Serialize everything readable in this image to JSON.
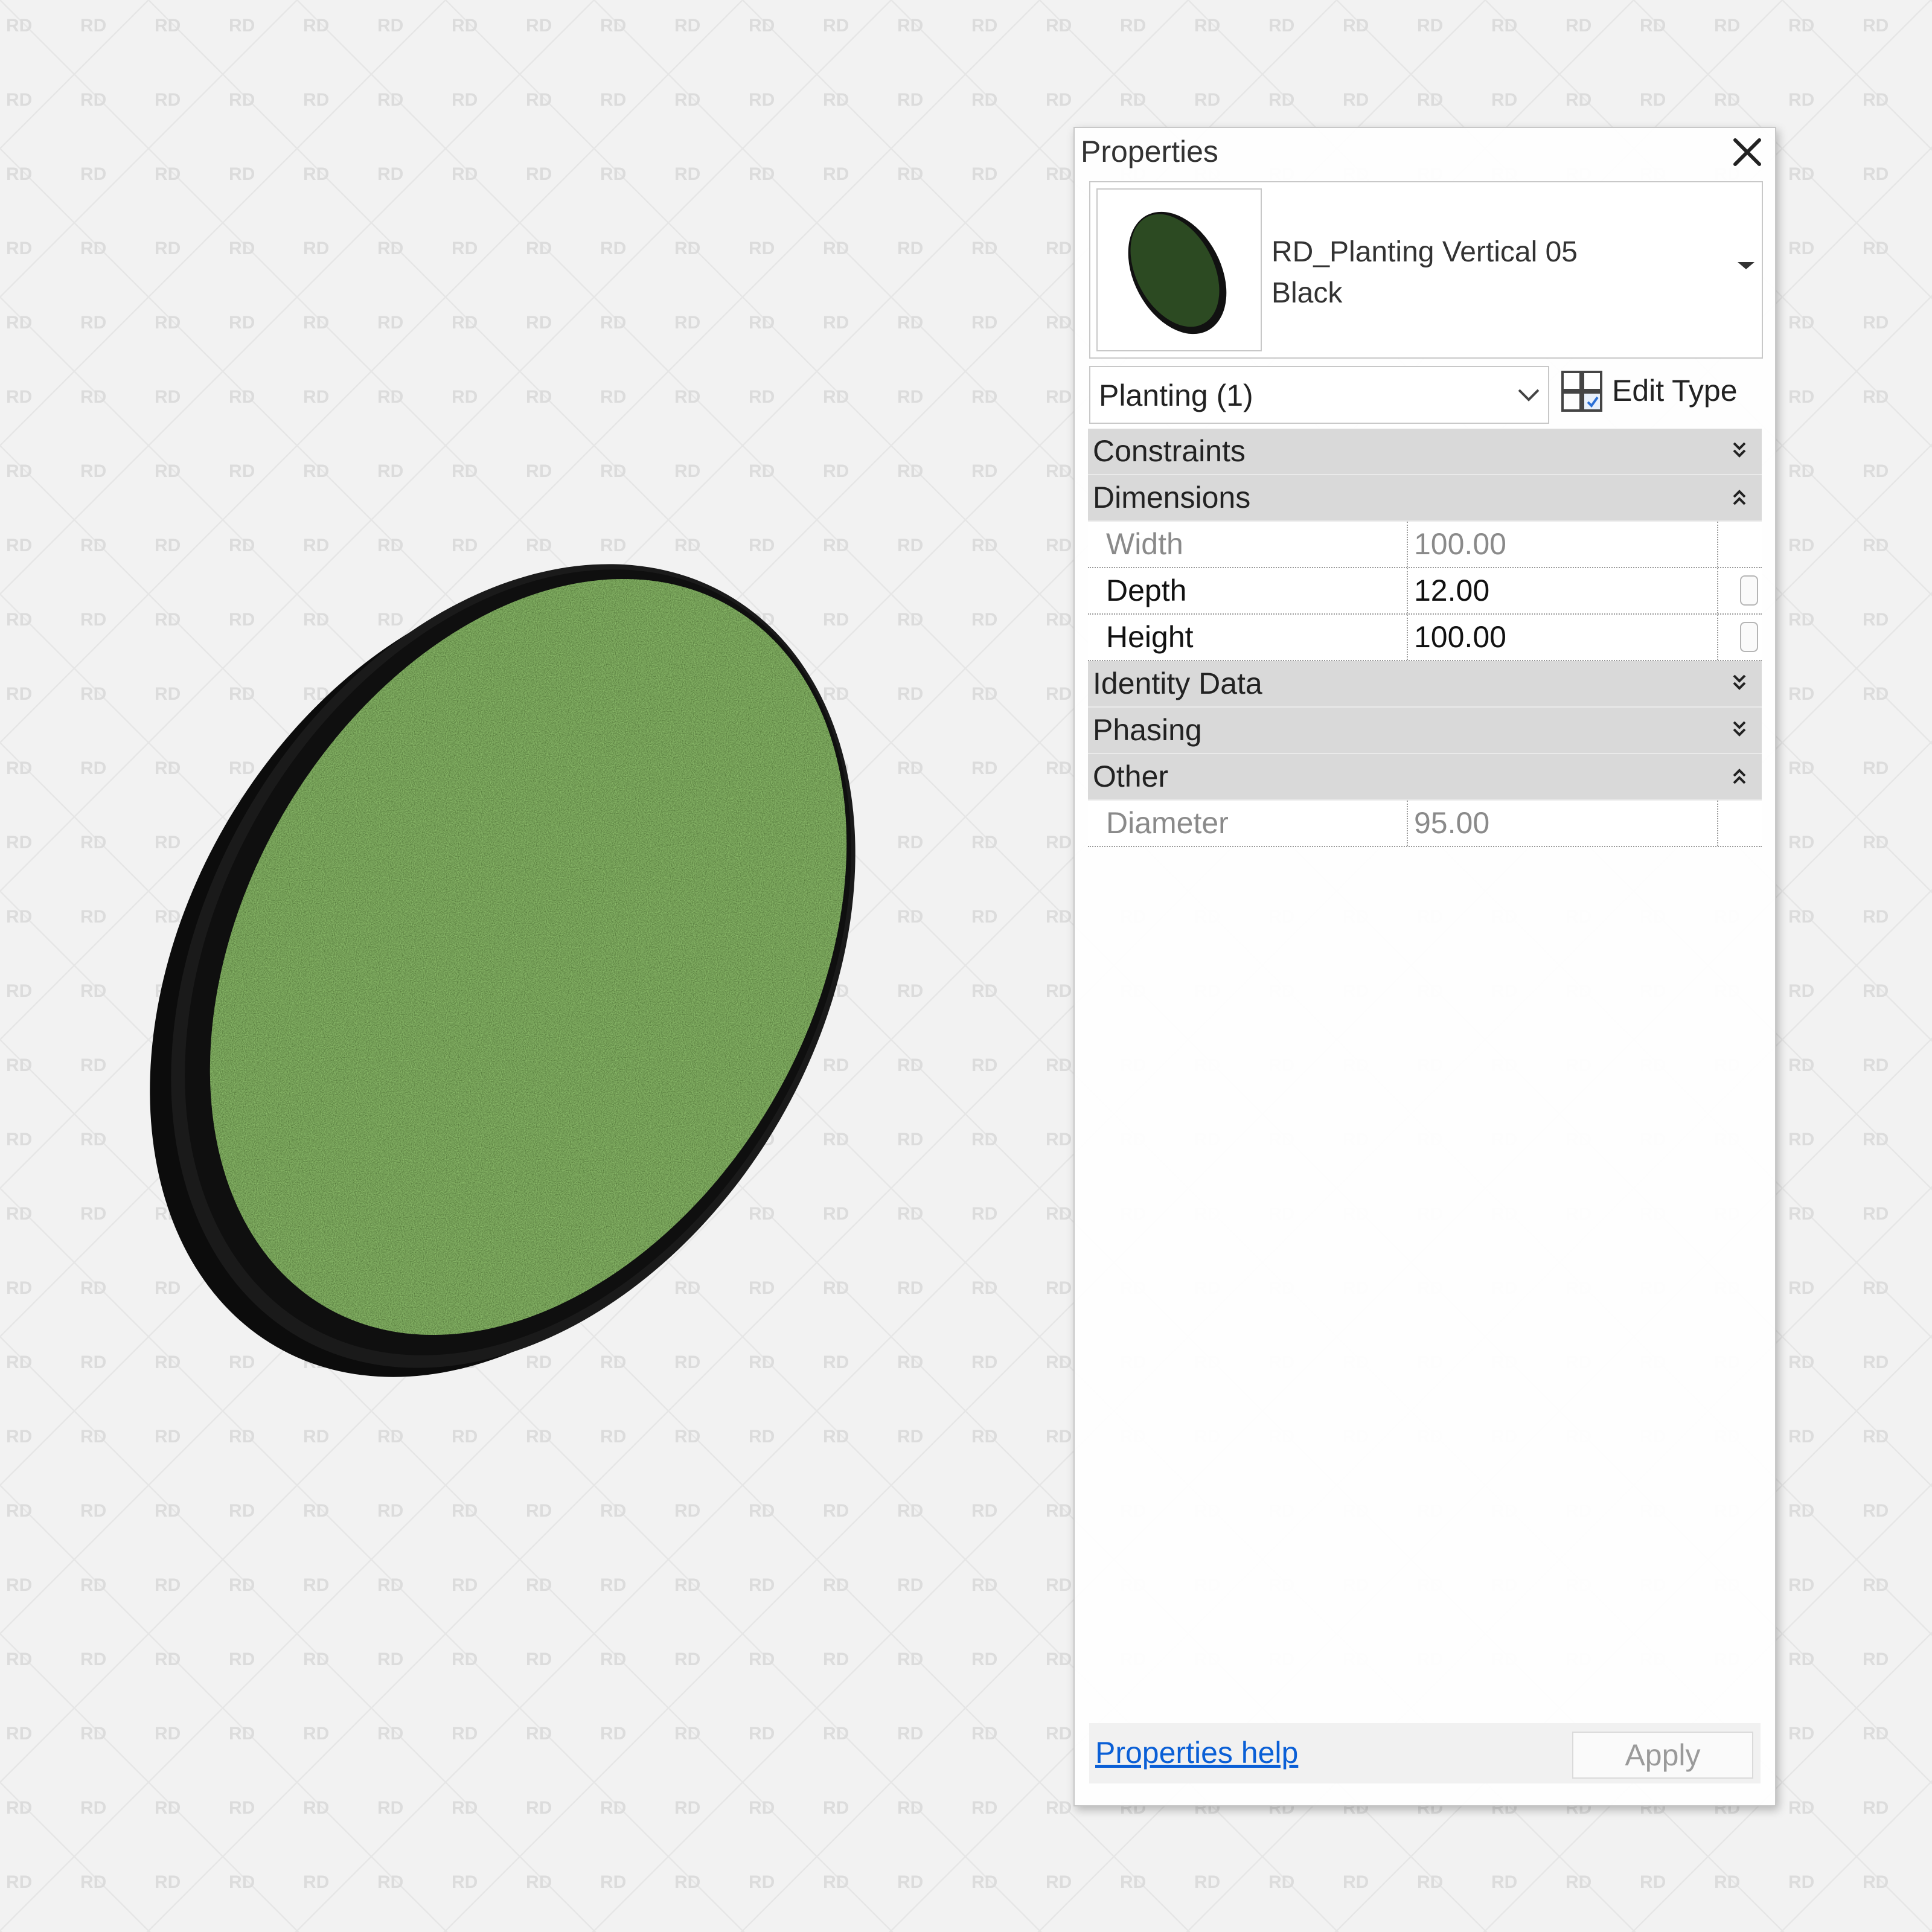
{
  "watermark": "RD",
  "palette": {
    "title": "Properties",
    "type_selector": {
      "name_line1": "RD_Planting Vertical 05",
      "name_line2": "Black"
    },
    "instance_filter": "Planting (1)",
    "edit_type_label": "Edit Type",
    "groups": [
      {
        "label": "Constraints",
        "state": "collapsed",
        "rows": []
      },
      {
        "label": "Dimensions",
        "state": "expanded",
        "rows": [
          {
            "name": "Width",
            "value": "100.00",
            "editable": false
          },
          {
            "name": "Depth",
            "value": "12.00",
            "editable": true
          },
          {
            "name": "Height",
            "value": "100.00",
            "editable": true
          }
        ]
      },
      {
        "label": "Identity Data",
        "state": "collapsed",
        "rows": []
      },
      {
        "label": "Phasing",
        "state": "collapsed",
        "rows": []
      },
      {
        "label": "Other",
        "state": "expanded",
        "rows": [
          {
            "name": "Diameter",
            "value": "95.00",
            "editable": false
          }
        ]
      }
    ],
    "help_link": "Properties help",
    "apply_label": "Apply"
  },
  "colors": {
    "planting_green": "#2c4a22",
    "frame_black": "#141414",
    "link_blue": "#0a5fd6"
  }
}
